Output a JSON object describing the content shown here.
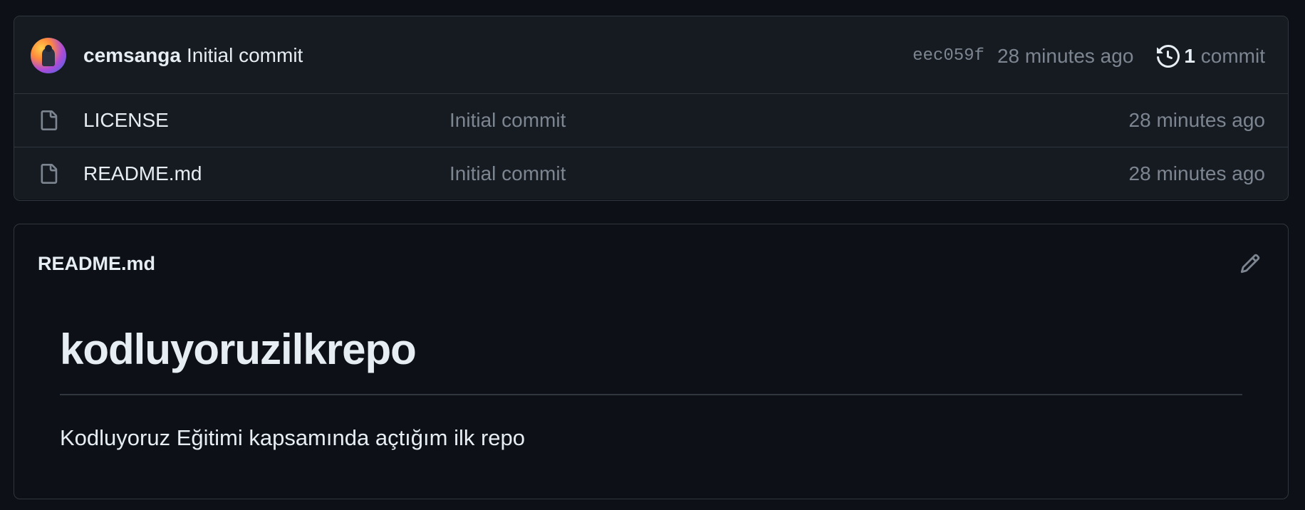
{
  "latest_commit": {
    "author": "cemsanga",
    "message": "Initial commit",
    "sha": "eec059f",
    "time": "28 minutes ago",
    "commit_count": "1",
    "commit_label": "commit"
  },
  "files": [
    {
      "name": "LICENSE",
      "message": "Initial commit",
      "time": "28 minutes ago",
      "icon": "file-icon"
    },
    {
      "name": "README.md",
      "message": "Initial commit",
      "time": "28 minutes ago",
      "icon": "file-icon"
    }
  ],
  "readme": {
    "filename": "README.md",
    "heading": "kodluyoruzilkrepo",
    "paragraph": "Kodluyoruz Eğitimi kapsamında açtığım ilk repo"
  },
  "colors": {
    "background": "#0d1117",
    "panel": "#161b22",
    "border": "#30363d",
    "text": "#e6edf3",
    "muted": "#7d8590"
  }
}
